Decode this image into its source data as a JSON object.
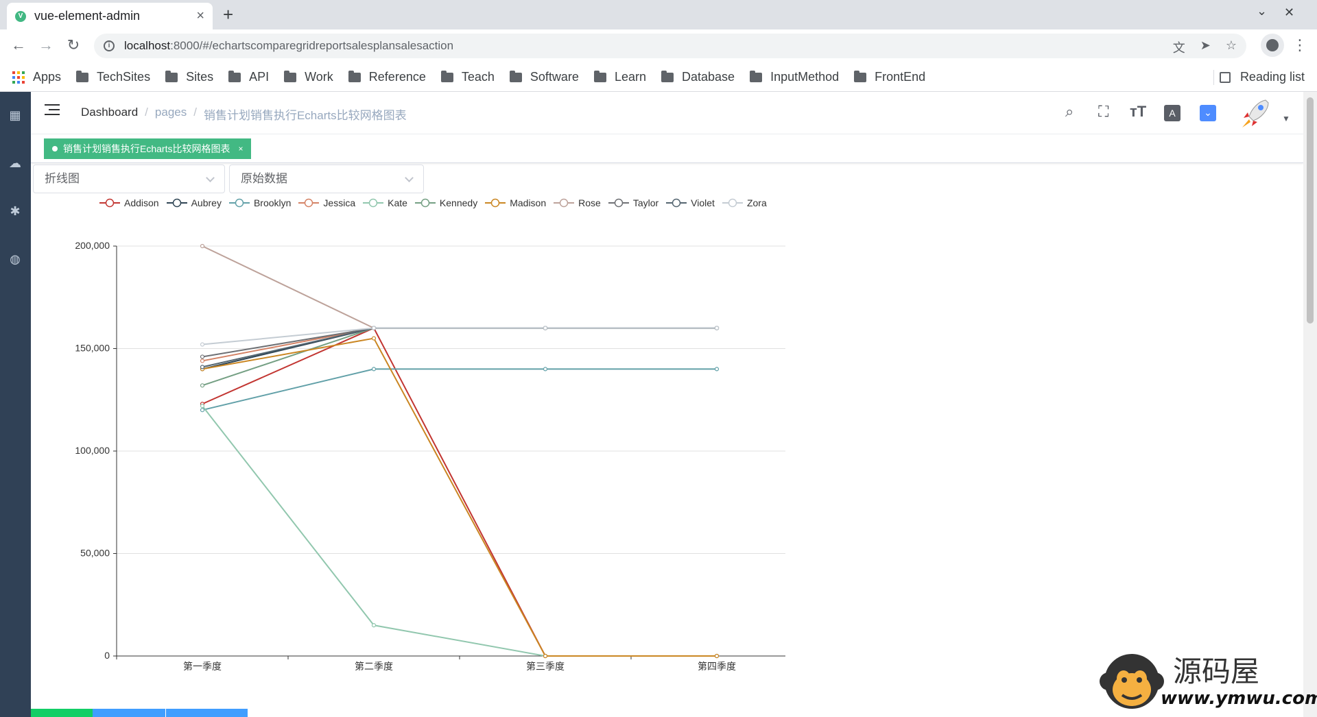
{
  "browser": {
    "tab_title": "vue-element-admin",
    "url_host": "localhost",
    "url_rest": ":8000/#/echartscomparegridreportsalesplansalesaction",
    "bookmarks": [
      "TechSites",
      "Sites",
      "API",
      "Work",
      "Reference",
      "Teach",
      "Software",
      "Learn",
      "Database",
      "InputMethod",
      "FrontEnd"
    ],
    "apps_label": "Apps",
    "reading_list": "Reading list"
  },
  "navbar": {
    "breadcrumb": [
      "Dashboard",
      "pages",
      "销售计划销售执行Echarts比较网格图表"
    ]
  },
  "tags": {
    "active": "销售计划销售执行Echarts比较网格图表",
    "close": "×"
  },
  "filters": {
    "chart_type": "折线图",
    "data_mode": "原始数据"
  },
  "watermark": {
    "name": "源码屋",
    "url": "www.ymwu.com"
  },
  "colors": {
    "accent_green": "#42b983",
    "sidebar": "#304156"
  },
  "chart_data": {
    "type": "line",
    "categories": [
      "第一季度",
      "第二季度",
      "第三季度",
      "第四季度"
    ],
    "ylim": [
      0,
      200000
    ],
    "yticks": [
      0,
      50000,
      100000,
      150000,
      200000
    ],
    "ytick_labels": [
      "0",
      "50,000",
      "100,000",
      "150,000",
      "200,000"
    ],
    "legend_position": "top-left",
    "grid": true,
    "series": [
      {
        "name": "Addison",
        "color": "#c23531",
        "values": [
          123000,
          160000,
          0,
          0
        ]
      },
      {
        "name": "Aubrey",
        "color": "#2f4554",
        "values": [
          140000,
          160000,
          160000,
          160000
        ]
      },
      {
        "name": "Brooklyn",
        "color": "#61a0a8",
        "values": [
          120000,
          140000,
          140000,
          140000
        ]
      },
      {
        "name": "Jessica",
        "color": "#d48265",
        "values": [
          144000,
          160000,
          160000,
          160000
        ]
      },
      {
        "name": "Kate",
        "color": "#91c7ae",
        "values": [
          122000,
          15000,
          0,
          0
        ]
      },
      {
        "name": "Kennedy",
        "color": "#749f83",
        "values": [
          132000,
          160000,
          160000,
          160000
        ]
      },
      {
        "name": "Madison",
        "color": "#ca8622",
        "values": [
          140000,
          155000,
          0,
          0
        ]
      },
      {
        "name": "Rose",
        "color": "#bda29a",
        "values": [
          200000,
          160000,
          160000,
          160000
        ]
      },
      {
        "name": "Taylor",
        "color": "#6e7074",
        "values": [
          146000,
          160000,
          160000,
          160000
        ]
      },
      {
        "name": "Violet",
        "color": "#546570",
        "values": [
          141000,
          160000,
          160000,
          160000
        ]
      },
      {
        "name": "Zora",
        "color": "#c4ccd3",
        "values": [
          152000,
          160000,
          160000,
          160000
        ]
      }
    ]
  }
}
